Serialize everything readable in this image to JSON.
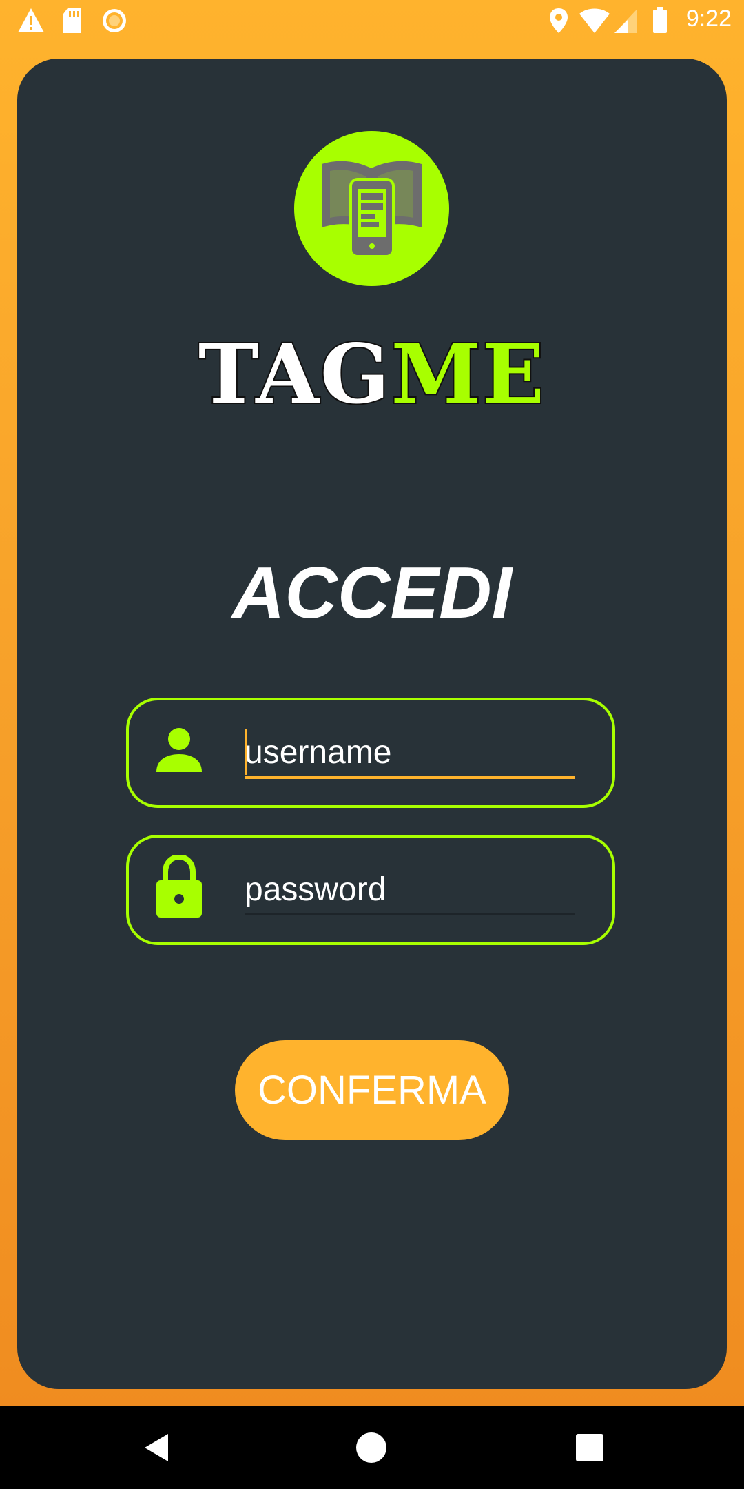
{
  "status_bar": {
    "time": "9:22",
    "left_icons": [
      "warning-icon",
      "sd-card-icon",
      "record-icon"
    ],
    "right_icons": [
      "location-icon",
      "wifi-icon",
      "signal-icon",
      "battery-icon"
    ]
  },
  "logo": {
    "icon": "book-phone-icon"
  },
  "brand": {
    "part1": "TAG",
    "part2": "ME"
  },
  "login": {
    "title": "ACCEDI",
    "username_placeholder": "username",
    "password_placeholder": "password",
    "confirm_label": "CONFERMA"
  },
  "nav": {
    "buttons": [
      "back-icon",
      "home-icon",
      "recents-icon"
    ]
  },
  "colors": {
    "accent_green": "#a8ff00",
    "accent_orange": "#ffb32d",
    "card_bg": "#283238"
  }
}
